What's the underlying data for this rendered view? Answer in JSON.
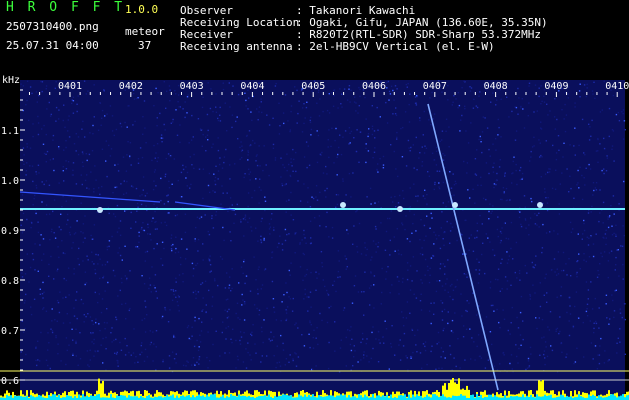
{
  "app": {
    "name": "H R O F F T",
    "version": "1.0.0"
  },
  "file": {
    "name": "2507310400.png",
    "datetime": "25.07.31 04:00"
  },
  "counter": {
    "label": "meteor",
    "value": "37"
  },
  "info": [
    {
      "label": "Observer",
      "value": ": Takanori Kawachi"
    },
    {
      "label": "Receiving Location",
      "value": ": Ogaki, Gifu, JAPAN (136.60E, 35.35N)"
    },
    {
      "label": "Receiver",
      "value": ": R820T2(RTL-SDR) SDR-Sharp 53.372MHz"
    },
    {
      "label": "Receiving antenna",
      "value": ": 2el-HB9CV Vertical (el. E-W)"
    }
  ],
  "spectrogram": {
    "unit": "kHz",
    "y_ticks": [
      "1.1",
      "1.0",
      "0.9",
      "0.8",
      "0.7",
      "0.6"
    ],
    "time_ticks": [
      "0401",
      "0402",
      "0403",
      "0404",
      "0405",
      "0406",
      "0407",
      "0408",
      "0409",
      "0410"
    ],
    "colors": {
      "background": "#0a0f5c",
      "line": "#ffff66",
      "carrier": "#70f0ff",
      "level": "#ffff00"
    }
  }
}
